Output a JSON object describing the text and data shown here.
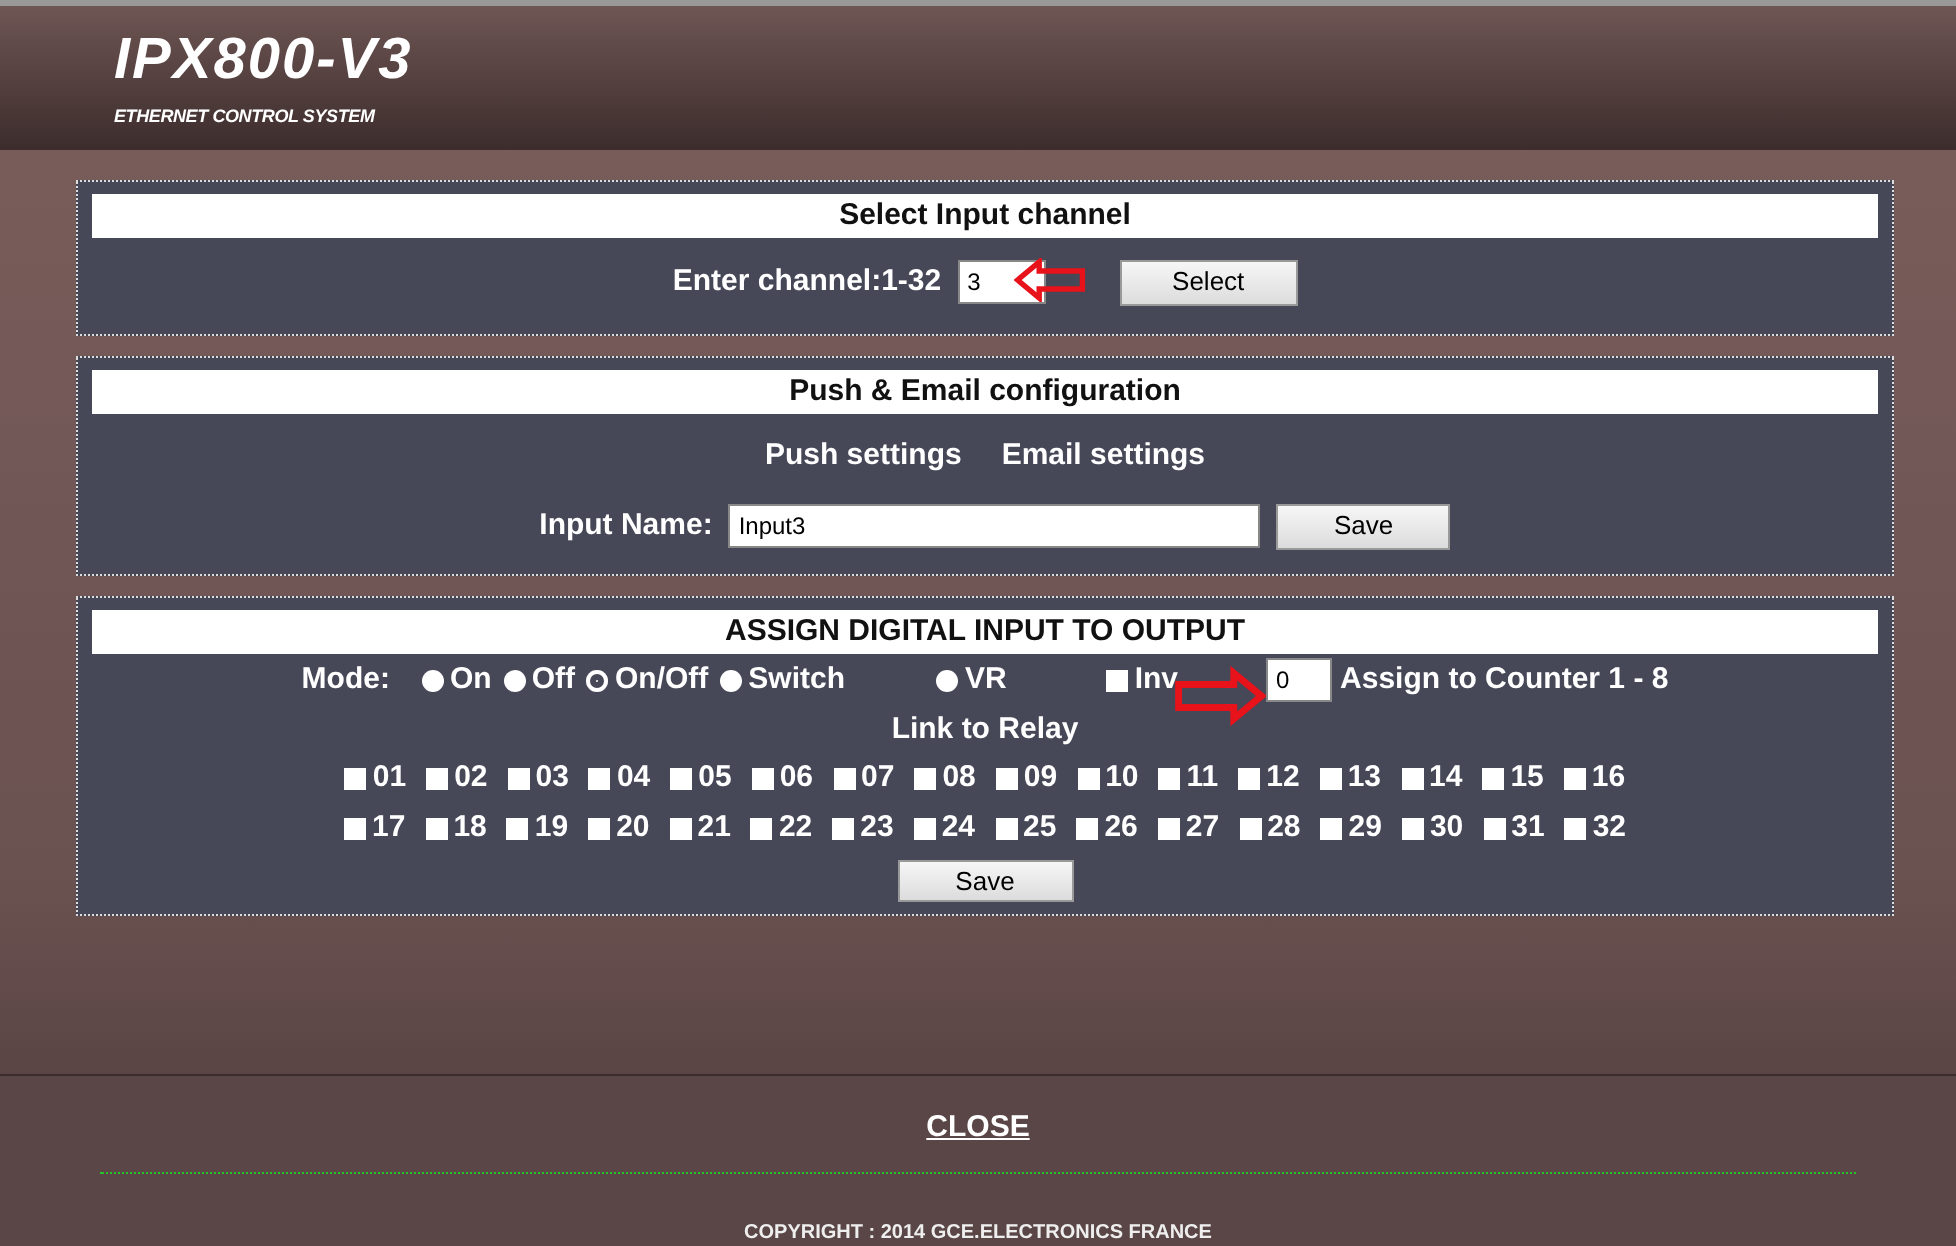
{
  "header": {
    "title": "IPX800-V3",
    "subtitle": "ETHERNET CONTROL SYSTEM"
  },
  "select_panel": {
    "title": "Select Input channel",
    "label": "Enter channel:1-32",
    "value": "3",
    "button": "Select"
  },
  "push_panel": {
    "title": "Push & Email configuration",
    "links": [
      "Push settings",
      "Email settings"
    ],
    "name_label": "Input Name:",
    "name_value": "Input3",
    "button": "Save"
  },
  "assign_panel": {
    "title": "ASSIGN DIGITAL INPUT TO OUTPUT",
    "mode_label": "Mode:",
    "modes": [
      {
        "label": "On",
        "selected": false
      },
      {
        "label": "Off",
        "selected": false
      },
      {
        "label": "On/Off",
        "selected": true
      },
      {
        "label": "Switch",
        "selected": false
      },
      {
        "label": "VR",
        "selected": false
      }
    ],
    "inv": {
      "label": "Inv",
      "checked": false
    },
    "counter": {
      "value": "0",
      "label": "Assign to Counter 1 - 8"
    },
    "relay_title": "Link to Relay",
    "relays": [
      {
        "label": "01",
        "checked": false
      },
      {
        "label": "02",
        "checked": false
      },
      {
        "label": "03",
        "checked": false
      },
      {
        "label": "04",
        "checked": false
      },
      {
        "label": "05",
        "checked": false
      },
      {
        "label": "06",
        "checked": false
      },
      {
        "label": "07",
        "checked": false
      },
      {
        "label": "08",
        "checked": false
      },
      {
        "label": "09",
        "checked": false
      },
      {
        "label": "10",
        "checked": false
      },
      {
        "label": "11",
        "checked": false
      },
      {
        "label": "12",
        "checked": false
      },
      {
        "label": "13",
        "checked": false
      },
      {
        "label": "14",
        "checked": false
      },
      {
        "label": "15",
        "checked": false
      },
      {
        "label": "16",
        "checked": false
      },
      {
        "label": "17",
        "checked": false
      },
      {
        "label": "18",
        "checked": false
      },
      {
        "label": "19",
        "checked": false
      },
      {
        "label": "20",
        "checked": false
      },
      {
        "label": "21",
        "checked": false
      },
      {
        "label": "22",
        "checked": false
      },
      {
        "label": "23",
        "checked": false
      },
      {
        "label": "24",
        "checked": false
      },
      {
        "label": "25",
        "checked": false
      },
      {
        "label": "26",
        "checked": false
      },
      {
        "label": "27",
        "checked": false
      },
      {
        "label": "28",
        "checked": false
      },
      {
        "label": "29",
        "checked": false
      },
      {
        "label": "30",
        "checked": false
      },
      {
        "label": "31",
        "checked": false
      },
      {
        "label": "32",
        "checked": false
      }
    ],
    "button": "Save"
  },
  "footer": {
    "close": "CLOSE",
    "copyright": "COPYRIGHT : 2014 GCE.ELECTRONICS FRANCE"
  }
}
